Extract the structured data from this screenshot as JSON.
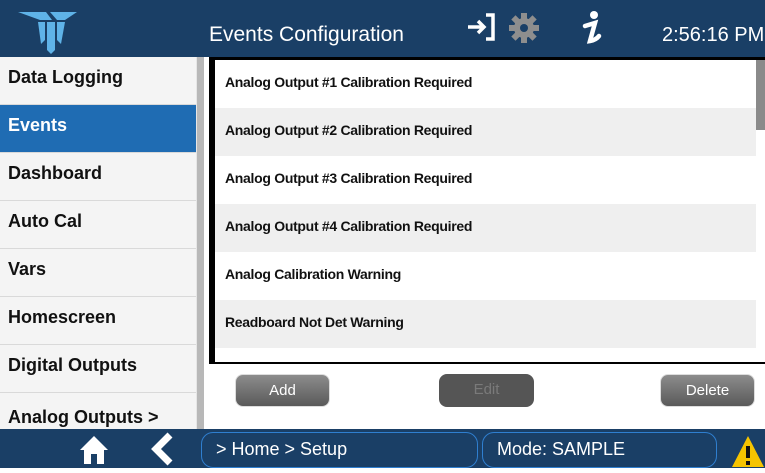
{
  "header": {
    "title": "Events Configuration",
    "clock": "2:56:16 PM",
    "icons": [
      "logo-icon",
      "exit-icon",
      "gear-icon",
      "info-icon"
    ]
  },
  "sidebar": {
    "items": [
      {
        "label": "Data Logging"
      },
      {
        "label": "Events",
        "active": true
      },
      {
        "label": "Dashboard"
      },
      {
        "label": "Auto Cal"
      },
      {
        "label": "Vars"
      },
      {
        "label": "Homescreen"
      },
      {
        "label": "Digital Outputs"
      },
      {
        "label": "Analog Outputs >"
      }
    ]
  },
  "events": {
    "rows": [
      "Analog Output #1 Calibration Required",
      "Analog Output #2 Calibration Required",
      "Analog Output #3 Calibration Required",
      "Analog Output #4 Calibration Required",
      "Analog Calibration Warning",
      "Readboard Not Det Warning"
    ]
  },
  "buttons": {
    "add": "Add",
    "edit": "Edit",
    "delete": "Delete"
  },
  "footer": {
    "breadcrumb": "> Home > Setup",
    "mode": "Mode: SAMPLE",
    "icons": [
      "home-icon",
      "back-icon",
      "warning-icon"
    ]
  },
  "colors": {
    "header": "#1a3f66",
    "active": "#1f6cb3",
    "warning": "#f5c400"
  }
}
